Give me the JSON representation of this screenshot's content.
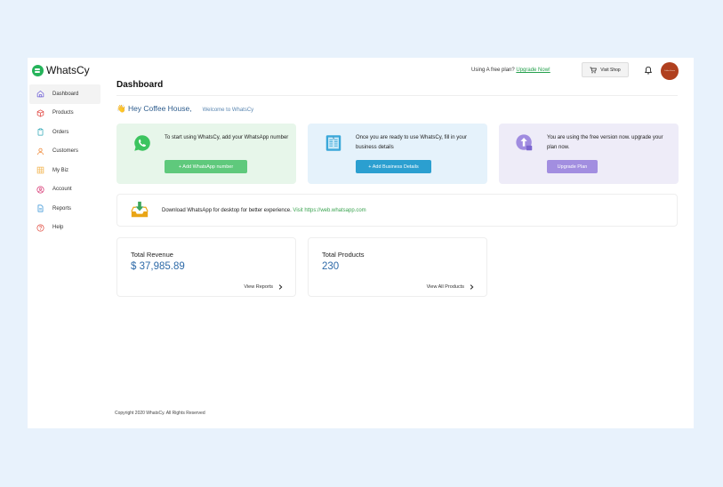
{
  "brand": {
    "name": "WhatsCy",
    "accent": "#25b35a"
  },
  "topbar": {
    "plan_text": "Using A free plan?",
    "plan_link": "Upgrade Now!",
    "visit_shop": "Visit Shop",
    "avatar_text": "Coffee House"
  },
  "sidebar": {
    "items": [
      {
        "label": "Dashboard",
        "icon": "home-icon"
      },
      {
        "label": "Products",
        "icon": "box-icon"
      },
      {
        "label": "Orders",
        "icon": "clipboard-icon"
      },
      {
        "label": "Customers",
        "icon": "user-icon"
      },
      {
        "label": "My Biz",
        "icon": "grid-icon"
      },
      {
        "label": "Account",
        "icon": "account-icon"
      },
      {
        "label": "Reports",
        "icon": "report-icon"
      },
      {
        "label": "Help",
        "icon": "help-icon"
      }
    ]
  },
  "main": {
    "title": "Dashboard",
    "greeting": "👋 Hey Coffee House,",
    "welcome": "Welcome to WhatsCy",
    "cards": {
      "whatsapp": {
        "text": "To start using WhatsCy, add your WhatsApp number",
        "button": "+ Add WhatsApp number"
      },
      "business": {
        "text": "Once you are ready to use WhatsCy, fill in your business details",
        "button": "+ Add Business Details"
      },
      "upgrade": {
        "text": "You are using the free version now. upgrade your plan now.",
        "button": "Upgrade Plan"
      }
    },
    "download": {
      "text": "Download WhatsApp for desktop for better experience.",
      "link": "Visit https://web.whatsapp.com"
    },
    "stats": {
      "revenue": {
        "label": "Total Revenue",
        "value": "$ 37,985.89",
        "link": "View Reports"
      },
      "products": {
        "label": "Total Products",
        "value": "230",
        "link": "View All Products"
      }
    }
  },
  "footer": {
    "text": "Copyright 2020 WhatsCy. All Rights Reserved"
  }
}
